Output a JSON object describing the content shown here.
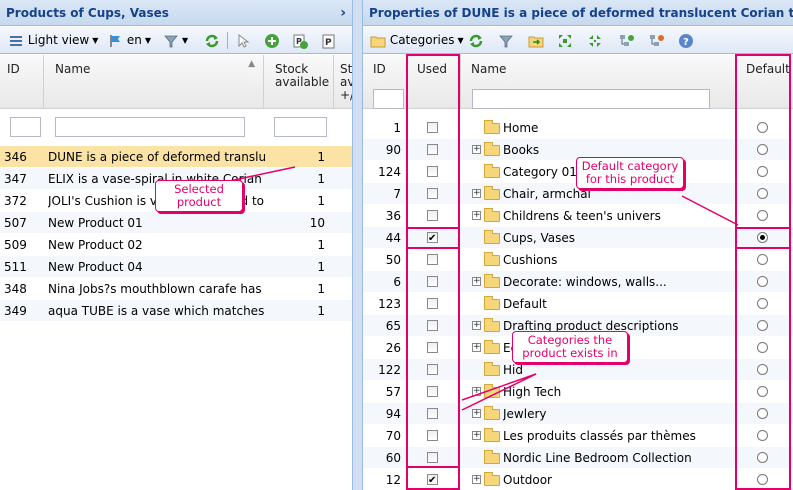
{
  "left": {
    "title": "Products of Cups, Vases",
    "toolbar": {
      "view_label": "Light view",
      "lang_label": "en"
    },
    "columns": {
      "id": "ID",
      "name": "Name",
      "stock": "Stock available",
      "stock2": "St av +/"
    },
    "rows": [
      {
        "id": "346",
        "name": "DUNE is a piece of deformed translucen",
        "stock": "1"
      },
      {
        "id": "347",
        "name": "ELIX is a vase-spiral in white Corian c",
        "stock": "1"
      },
      {
        "id": "372",
        "name": "JOLI's Cushion is very soft to hold to a",
        "stock": "1"
      },
      {
        "id": "507",
        "name": "New Product 01",
        "stock": "10"
      },
      {
        "id": "509",
        "name": "New Product 02",
        "stock": "1"
      },
      {
        "id": "511",
        "name": "New Product 04",
        "stock": "1"
      },
      {
        "id": "348",
        "name": "Nina Jobs?s mouthblown carafe has all t",
        "stock": "1"
      },
      {
        "id": "349",
        "name": "aqua TUBE is a vase which matches cor",
        "stock": "1"
      }
    ],
    "callout_selected": "Selected product"
  },
  "right": {
    "title": "Properties of DUNE is a piece of deformed translucent Corian that can",
    "toolbar": {
      "categories_label": "Categories"
    },
    "columns": {
      "id": "ID",
      "used": "Used",
      "name": "Name",
      "default": "Default"
    },
    "rows": [
      {
        "id": "1",
        "used": false,
        "expand": false,
        "name": "Home",
        "default": false
      },
      {
        "id": "90",
        "used": false,
        "expand": true,
        "name": "Books",
        "default": false
      },
      {
        "id": "124",
        "used": false,
        "expand": false,
        "name": "Category 01",
        "default": false
      },
      {
        "id": "7",
        "used": false,
        "expand": true,
        "name": "Chair, armchai",
        "default": false
      },
      {
        "id": "36",
        "used": false,
        "expand": true,
        "name": "Childrens & teen's univers",
        "default": false
      },
      {
        "id": "44",
        "used": true,
        "expand": false,
        "name": "Cups, Vases",
        "default": true
      },
      {
        "id": "50",
        "used": false,
        "expand": false,
        "name": "Cushions",
        "default": false
      },
      {
        "id": "6",
        "used": false,
        "expand": true,
        "name": "Decorate: windows, walls...",
        "default": false
      },
      {
        "id": "123",
        "used": false,
        "expand": false,
        "name": "Default",
        "default": false
      },
      {
        "id": "65",
        "used": false,
        "expand": true,
        "name": "Drafting product descriptions",
        "default": false
      },
      {
        "id": "26",
        "used": false,
        "expand": true,
        "name": "Ec",
        "default": false
      },
      {
        "id": "122",
        "used": false,
        "expand": false,
        "name": "Hid",
        "default": false
      },
      {
        "id": "57",
        "used": false,
        "expand": true,
        "name": "High Tech",
        "default": false
      },
      {
        "id": "94",
        "used": false,
        "expand": true,
        "name": "Jewlery",
        "default": false
      },
      {
        "id": "70",
        "used": false,
        "expand": true,
        "name": "Les produits classés par thèmes",
        "default": false
      },
      {
        "id": "60",
        "used": false,
        "expand": false,
        "name": "Nordic Line Bedroom Collection",
        "default": false
      },
      {
        "id": "12",
        "used": true,
        "expand": true,
        "name": "Outdoor",
        "default": false
      }
    ],
    "callout_default": "Default category for this product",
    "callout_categories": "Categories the product exists in"
  },
  "colors": {
    "highlight": "#e4006b",
    "selected_row": "#fbe3a6",
    "title_text": "#15428b"
  }
}
